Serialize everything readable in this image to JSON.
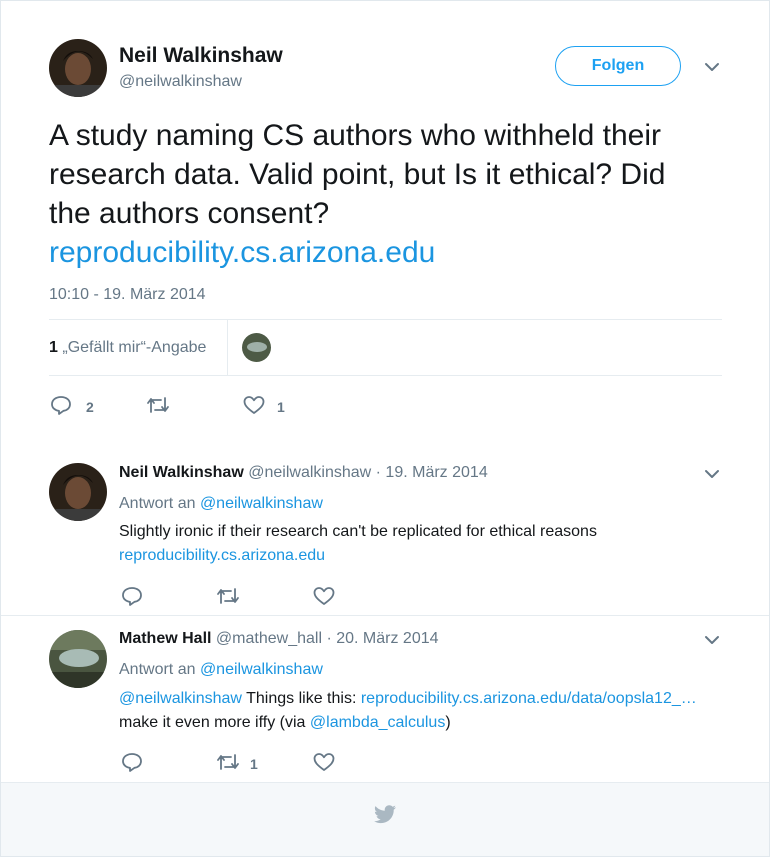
{
  "main_tweet": {
    "author_name": "Neil Walkinshaw",
    "author_handle": "@neilwalkinshaw",
    "follow_label": "Folgen",
    "text": "A study naming CS authors who withheld their research data. Valid point, but Is it ethical? Did the authors consent?",
    "link": "reproducibility.cs.arizona.edu",
    "timestamp": "10:10 - 19. März 2014",
    "likes_count": "1",
    "likes_label": "„Gefällt mir“-Angabe",
    "reply_count": "2",
    "like_action_count": "1"
  },
  "replies": [
    {
      "author_name": "Neil Walkinshaw",
      "author_handle": "@neilwalkinshaw",
      "date": "· 19. März 2014",
      "reply_to_prefix": "Antwort an",
      "reply_to": "@neilwalkinshaw",
      "text": "Slightly ironic if their research can't be replicated for ethical reasons",
      "link": "reproducibility.cs.arizona.edu"
    },
    {
      "author_name": "Mathew Hall",
      "author_handle": "@mathew_hall",
      "date": "· 20. März 2014",
      "reply_to_prefix": "Antwort an",
      "reply_to": "@neilwalkinshaw",
      "mention": "@neilwalkinshaw",
      "text_mid": "Things like this:",
      "link": "reproducibility.cs.arizona.edu/data/oopsla12_…",
      "text_line2": "make it even more iffy (via",
      "mention2": "@lambda_calculus",
      "text_end": ")",
      "retweet_count": "1"
    }
  ],
  "icons": [
    "chevron-down-icon",
    "reply-icon",
    "retweet-icon",
    "heart-icon",
    "twitter-bird-icon"
  ]
}
